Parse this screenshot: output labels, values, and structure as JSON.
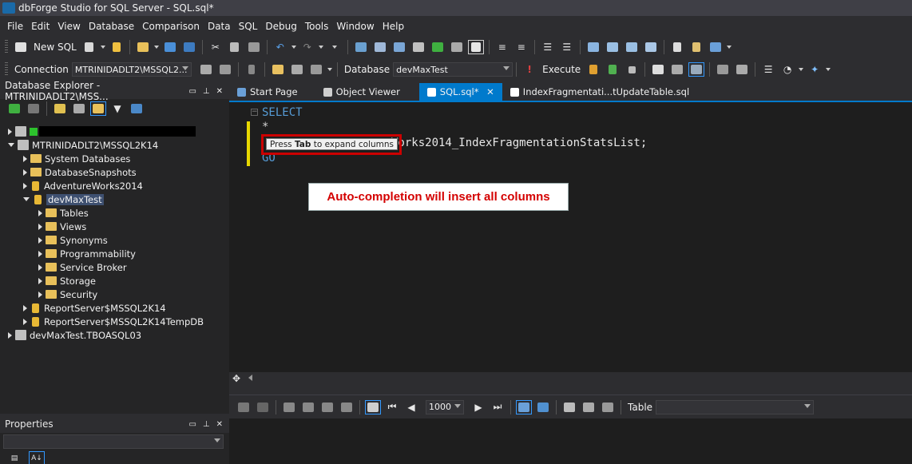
{
  "window": {
    "title": "dbForge Studio for SQL Server - SQL.sql*"
  },
  "menu": [
    "File",
    "Edit",
    "View",
    "Database",
    "Comparison",
    "Data",
    "SQL",
    "Debug",
    "Tools",
    "Window",
    "Help"
  ],
  "toolbar1": {
    "new_sql": "New SQL"
  },
  "toolbar2": {
    "connection_label": "Connection",
    "connection_value": "MTRINIDADLT2\\MSSQL2...",
    "database_label": "Database",
    "database_value": "devMaxTest",
    "execute_label": "Execute"
  },
  "db_explorer": {
    "title": "Database Explorer - MTRINIDADLT2\\MSS...",
    "tree": [
      "MTRINIDADLT2\\MSSQL2K14",
      "System Databases",
      "DatabaseSnapshots",
      "AdventureWorks2014",
      "devMaxTest",
      "Tables",
      "Views",
      "Synonyms",
      "Programmability",
      "Service Broker",
      "Storage",
      "Security",
      "ReportServer$MSSQL2K14",
      "ReportServer$MSSQL2K14TempDB",
      "devMaxTest.TBOASQL03"
    ]
  },
  "properties": {
    "title": "Properties"
  },
  "tabs": [
    "Start Page",
    "Object Viewer",
    "SQL.sql*",
    "IndexFragmentati...tUpdateTable.sql"
  ],
  "editor": {
    "line1": "SELECT",
    "line2": "*",
    "line3_rest": "Works2014_IndexFragmentationStatsList;",
    "line4": "GO",
    "tooltip_pre": "Press ",
    "tooltip_key": "Tab",
    "tooltip_post": " to expand columns",
    "callout": "Auto-completion will insert all columns"
  },
  "grid_toolbar": {
    "rows_value": "1000",
    "table_label": "Table"
  },
  "colors": {
    "accent": "#007acc",
    "callout_text": "#d40000",
    "highlight_box": "#cc0000"
  }
}
